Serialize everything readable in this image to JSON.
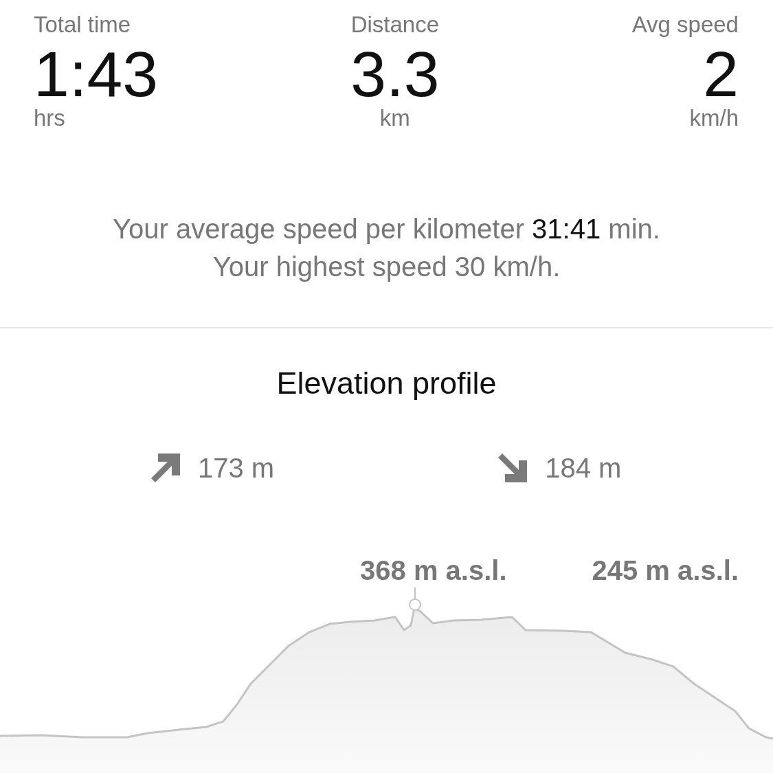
{
  "stats": [
    {
      "label": "Total time",
      "value": "1:43",
      "unit": "hrs"
    },
    {
      "label": "Distance",
      "value": "3.3",
      "unit": "km"
    },
    {
      "label": "Avg speed",
      "value": "2",
      "unit": "km/h"
    }
  ],
  "summary": {
    "pace_before": "Your average speed per kilometer ",
    "pace_value": "31:41",
    "pace_after": " min.",
    "top_speed": "Your highest speed 30 km/h."
  },
  "elevation": {
    "title": "Elevation profile",
    "ascent": "173 m",
    "descent": "184 m",
    "peak_label": "368 m a.s.l.",
    "end_label": "245 m a.s.l."
  }
}
